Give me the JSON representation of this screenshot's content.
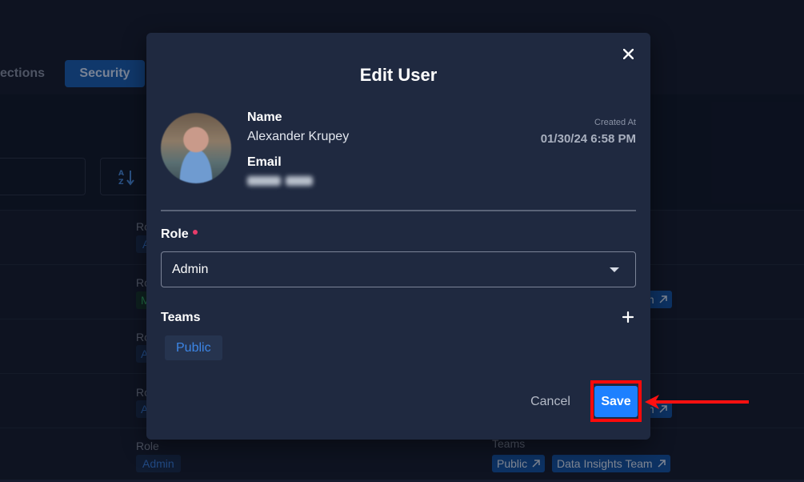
{
  "background": {
    "tabs": {
      "connections": "ections",
      "security": "Security"
    },
    "rows": [
      {
        "role_label": "Ro",
        "role_value": "A"
      },
      {
        "role_label": "Rol",
        "role_value": "M",
        "team_tail": "m"
      },
      {
        "role_label": "Rol",
        "role_value": "A"
      },
      {
        "role_label": "Rol",
        "role_value": "A",
        "team_tail": "m"
      },
      {
        "role_label": "Role",
        "role_value": "Admin",
        "teams_label": "Teams",
        "teams": [
          "Public",
          "Data Insights Team"
        ]
      }
    ]
  },
  "modal": {
    "title": "Edit User",
    "user": {
      "name_label": "Name",
      "name_value": "Alexander Krupey",
      "email_label": "Email"
    },
    "created_at": {
      "label": "Created At",
      "value": "01/30/24 6:58 PM"
    },
    "role": {
      "label": "Role",
      "selected": "Admin"
    },
    "teams": {
      "label": "Teams",
      "items": [
        "Public"
      ]
    },
    "actions": {
      "cancel": "Cancel",
      "save": "Save"
    }
  },
  "colors": {
    "accent": "#1d80ff",
    "highlight": "#ff0a0a",
    "required": "#e83c6a"
  }
}
